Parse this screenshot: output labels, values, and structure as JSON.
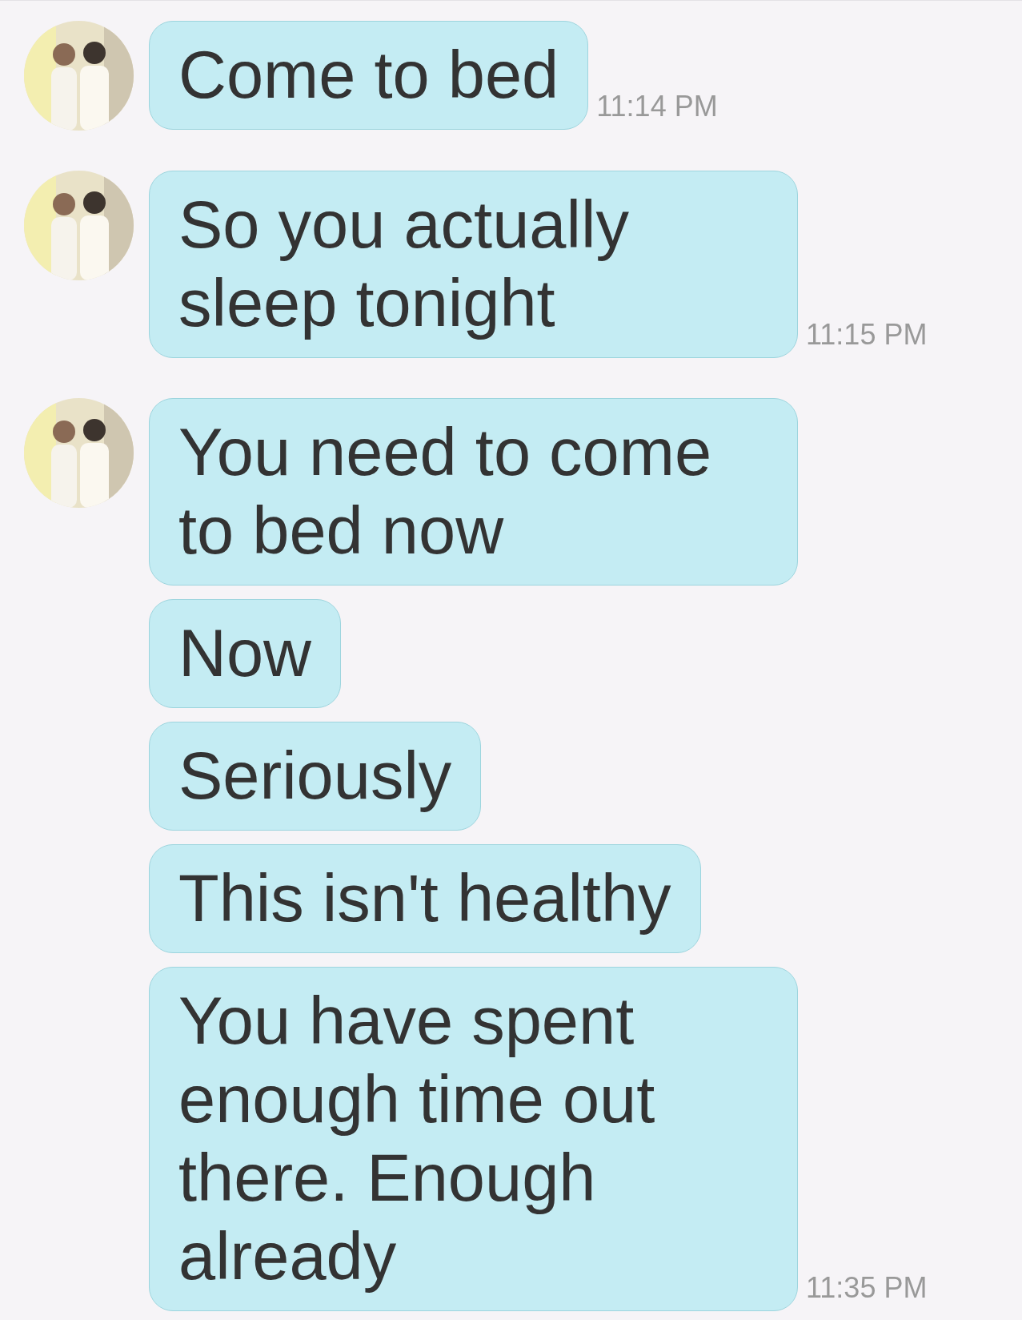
{
  "messages": [
    {
      "text": "Come to bed",
      "avatar": true,
      "time": "11:14 PM"
    },
    {
      "text": "So you actually sleep tonight",
      "avatar": true,
      "time": "11:15 PM"
    },
    {
      "text": "You need to come to bed now",
      "avatar": true
    },
    {
      "text": "Now",
      "avatar": false
    },
    {
      "text": "Seriously",
      "avatar": false
    },
    {
      "text": "This isn't healthy",
      "avatar": false
    },
    {
      "text": "You have spent enough time out there. Enough already",
      "avatar": false,
      "time": "11:35 PM"
    }
  ]
}
